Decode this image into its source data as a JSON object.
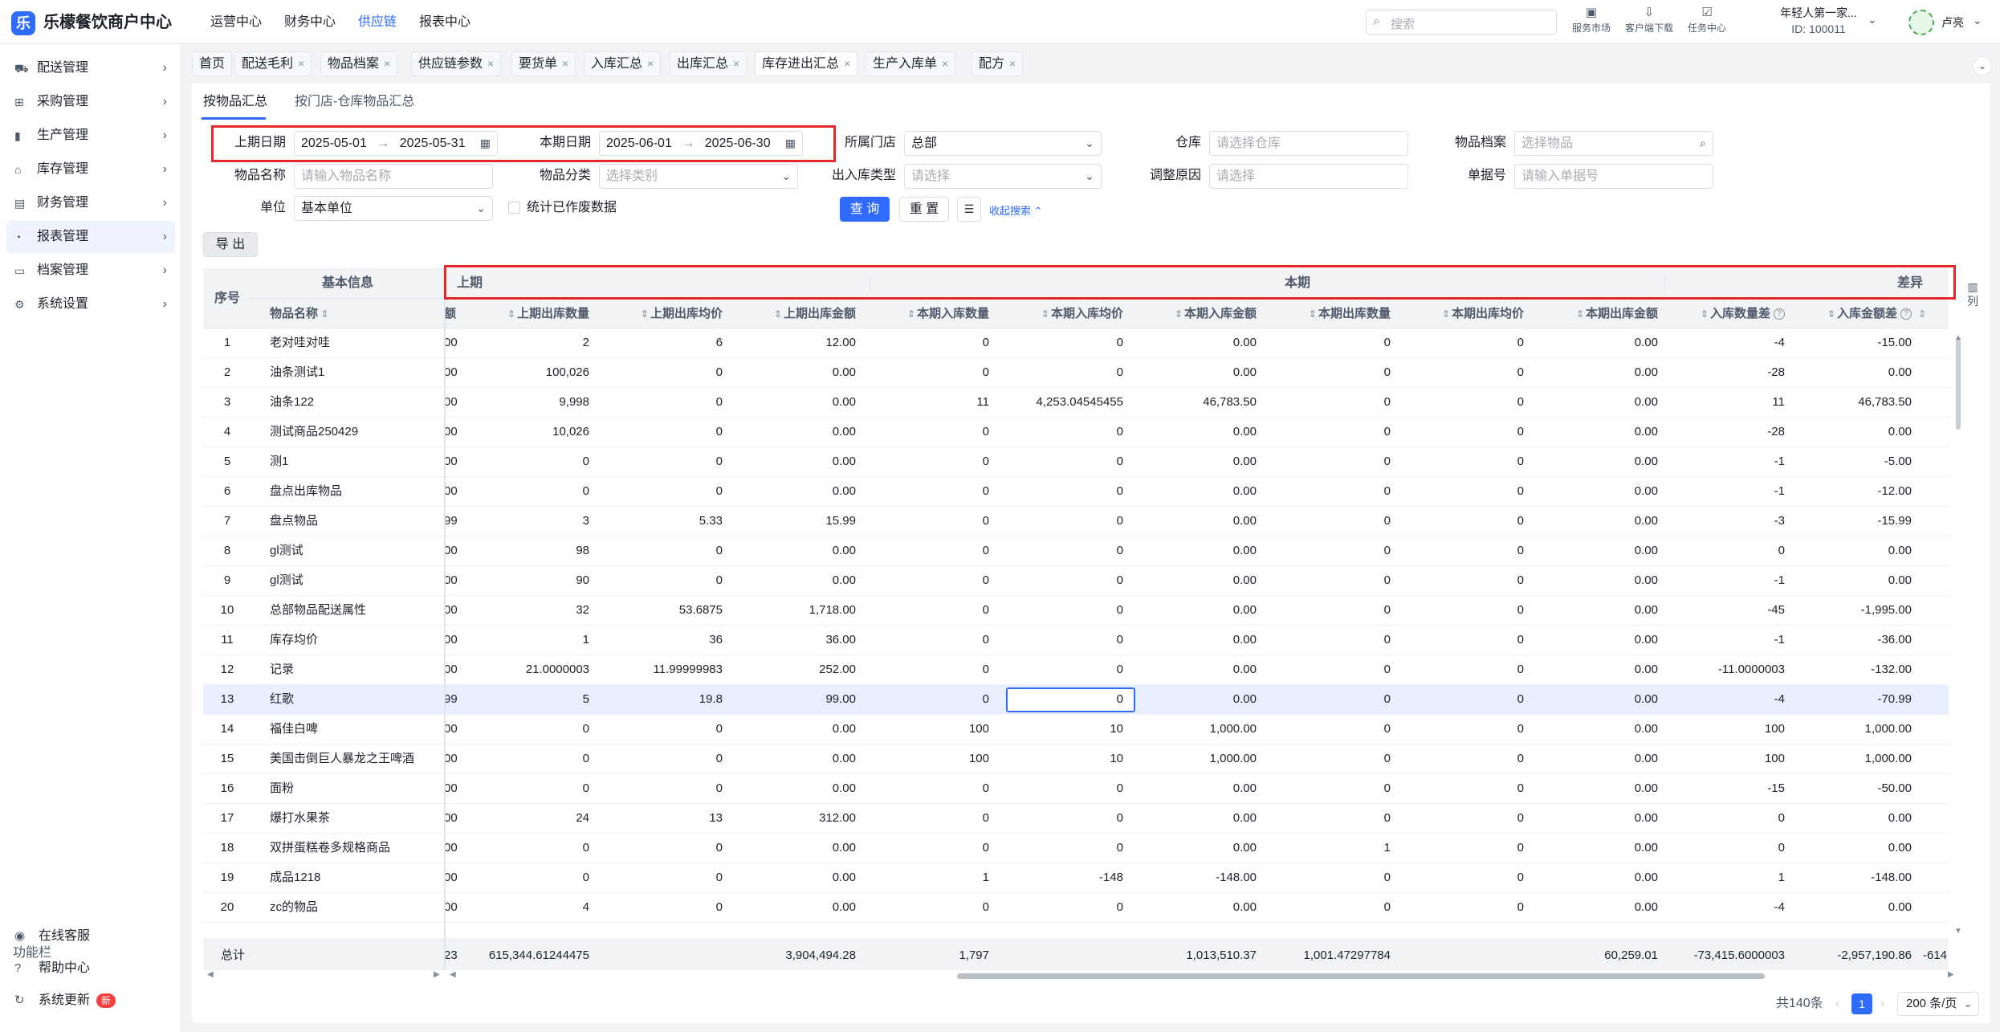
{
  "app": {
    "title": "乐檬餐饮商户中心",
    "logo_glyph": "乐"
  },
  "topnav": [
    {
      "label": "运营中心",
      "active": false
    },
    {
      "label": "财务中心",
      "active": false
    },
    {
      "label": "供应链",
      "active": true
    },
    {
      "label": "报表中心",
      "active": false
    }
  ],
  "search": {
    "placeholder": "搜索",
    "icon": "search-icon"
  },
  "tools": [
    {
      "label": "服务市场",
      "icon": "store-icon",
      "glyph": "▣"
    },
    {
      "label": "客户端下载",
      "icon": "download-icon",
      "glyph": "⇩"
    },
    {
      "label": "任务中心",
      "icon": "task-icon",
      "glyph": "☑"
    }
  ],
  "user": {
    "org": "年轻人第一家...",
    "id": "ID: 100011",
    "name": "卢亮"
  },
  "sidebar": {
    "items": [
      {
        "label": "配送管理",
        "icon": "truck-icon",
        "glyph": "⛟",
        "active": false
      },
      {
        "label": "采购管理",
        "icon": "cart-icon",
        "glyph": "⊞",
        "active": false
      },
      {
        "label": "生产管理",
        "icon": "bar-chart-icon",
        "glyph": "▮",
        "active": false
      },
      {
        "label": "库存管理",
        "icon": "warehouse-icon",
        "glyph": "⌂",
        "active": false
      },
      {
        "label": "财务管理",
        "icon": "wallet-icon",
        "glyph": "▤",
        "active": false
      },
      {
        "label": "报表管理",
        "icon": "report-icon",
        "glyph": "◔",
        "active": true
      },
      {
        "label": "档案管理",
        "icon": "archive-icon",
        "glyph": "▭",
        "active": false
      },
      {
        "label": "系统设置",
        "icon": "gear-icon",
        "glyph": "⚙",
        "active": false
      }
    ],
    "section_label": "功能栏",
    "footer": [
      {
        "label": "在线客服",
        "icon": "headset-icon",
        "glyph": "◉"
      },
      {
        "label": "帮助中心",
        "icon": "help-icon",
        "glyph": "?"
      },
      {
        "label": "系统更新",
        "icon": "refresh-icon",
        "glyph": "↻",
        "badge": "新"
      }
    ]
  },
  "tabs": [
    {
      "label": "首页",
      "closable": false,
      "active": false
    },
    {
      "label": "配送毛利",
      "closable": true,
      "active": false
    },
    {
      "label": "物品档案",
      "closable": true,
      "active": false
    },
    {
      "label": "供应链参数",
      "closable": true,
      "active": false
    },
    {
      "label": "要货单",
      "closable": true,
      "active": false
    },
    {
      "label": "入库汇总",
      "closable": true,
      "active": false
    },
    {
      "label": "出库汇总",
      "closable": true,
      "active": false
    },
    {
      "label": "库存进出汇总",
      "closable": true,
      "active": true
    },
    {
      "label": "生产入库单",
      "closable": true,
      "active": false
    },
    {
      "label": "配方",
      "closable": true,
      "active": false
    }
  ],
  "subtabs": [
    {
      "label": "按物品汇总",
      "active": true
    },
    {
      "label": "按门店-仓库物品汇总",
      "active": false
    }
  ],
  "filters": {
    "prev_period": {
      "label": "上期日期",
      "start": "2025-05-01",
      "end": "2025-05-31",
      "sep": "→"
    },
    "cur_period": {
      "label": "本期日期",
      "start": "2025-06-01",
      "end": "2025-06-30",
      "sep": "→"
    },
    "store": {
      "label": "所属门店",
      "value": "总部"
    },
    "warehouse": {
      "label": "仓库",
      "placeholder": "请选择仓库"
    },
    "item_file": {
      "label": "物品档案",
      "placeholder": "选择物品"
    },
    "item_name": {
      "label": "物品名称",
      "placeholder": "请输入物品名称"
    },
    "item_category": {
      "label": "物品分类",
      "placeholder": "选择类别"
    },
    "io_type": {
      "label": "出入库类型",
      "placeholder": "请选择"
    },
    "adjust_reason": {
      "label": "调整原因",
      "placeholder": "请选择"
    },
    "doc_no": {
      "label": "单据号",
      "placeholder": "请输入单据号"
    },
    "unit": {
      "label": "单位",
      "value": "基本单位"
    },
    "voided": {
      "label": "统计已作废数据",
      "checked": false
    },
    "query_btn": "查 询",
    "reset_btn": "重 置",
    "collapse_link": "收起搜索"
  },
  "export_btn": "导 出",
  "table": {
    "groups": {
      "basic": "基本信息",
      "prev": "上期",
      "cur": "本期",
      "diff": "差异"
    },
    "headers": {
      "seq": "序号",
      "name": "物品名称",
      "prev_amount_cut": "额",
      "prev_out_qty": "上期出库数量",
      "prev_out_avg": "上期出库均价",
      "prev_out_amt": "上期出库金额",
      "cur_in_qty": "本期入库数量",
      "cur_in_avg": "本期入库均价",
      "cur_in_amt": "本期入库金额",
      "cur_out_qty": "本期出库数量",
      "cur_out_avg": "本期出库均价",
      "cur_out_amt": "本期出库金额",
      "in_qty_diff": "入库数量差",
      "in_amt_diff": "入库金额差",
      "next_cut": "⇕"
    },
    "rows": [
      {
        "seq": "1",
        "name": "老对哇对哇",
        "pre": "00",
        "poq": "2",
        "poa": "6",
        "pom": "12.00",
        "ciq": "0",
        "cia": "0",
        "cim": "0.00",
        "coq": "0",
        "coa": "0",
        "com": "0.00",
        "dq": "-4",
        "dm": "-15.00"
      },
      {
        "seq": "2",
        "name": "油条测试1",
        "pre": "00",
        "poq": "100,026",
        "poa": "0",
        "pom": "0.00",
        "ciq": "0",
        "cia": "0",
        "cim": "0.00",
        "coq": "0",
        "coa": "0",
        "com": "0.00",
        "dq": "-28",
        "dm": "0.00"
      },
      {
        "seq": "3",
        "name": "油条122",
        "pre": "00",
        "poq": "9,998",
        "poa": "0",
        "pom": "0.00",
        "ciq": "11",
        "cia": "4,253.04545455",
        "cim": "46,783.50",
        "coq": "0",
        "coa": "0",
        "com": "0.00",
        "dq": "11",
        "dm": "46,783.50"
      },
      {
        "seq": "4",
        "name": "测试商品250429",
        "pre": "00",
        "poq": "10,026",
        "poa": "0",
        "pom": "0.00",
        "ciq": "0",
        "cia": "0",
        "cim": "0.00",
        "coq": "0",
        "coa": "0",
        "com": "0.00",
        "dq": "-28",
        "dm": "0.00"
      },
      {
        "seq": "5",
        "name": "测1",
        "pre": "00",
        "poq": "0",
        "poa": "0",
        "pom": "0.00",
        "ciq": "0",
        "cia": "0",
        "cim": "0.00",
        "coq": "0",
        "coa": "0",
        "com": "0.00",
        "dq": "-1",
        "dm": "-5.00"
      },
      {
        "seq": "6",
        "name": "盘点出库物品",
        "pre": "00",
        "poq": "0",
        "poa": "0",
        "pom": "0.00",
        "ciq": "0",
        "cia": "0",
        "cim": "0.00",
        "coq": "0",
        "coa": "0",
        "com": "0.00",
        "dq": "-1",
        "dm": "-12.00"
      },
      {
        "seq": "7",
        "name": "盘点物品",
        "pre": "99",
        "poq": "3",
        "poa": "5.33",
        "pom": "15.99",
        "ciq": "0",
        "cia": "0",
        "cim": "0.00",
        "coq": "0",
        "coa": "0",
        "com": "0.00",
        "dq": "-3",
        "dm": "-15.99"
      },
      {
        "seq": "8",
        "name": "gl测试",
        "pre": "00",
        "poq": "98",
        "poa": "0",
        "pom": "0.00",
        "ciq": "0",
        "cia": "0",
        "cim": "0.00",
        "coq": "0",
        "coa": "0",
        "com": "0.00",
        "dq": "0",
        "dm": "0.00"
      },
      {
        "seq": "9",
        "name": "gl测试",
        "pre": "00",
        "poq": "90",
        "poa": "0",
        "pom": "0.00",
        "ciq": "0",
        "cia": "0",
        "cim": "0.00",
        "coq": "0",
        "coa": "0",
        "com": "0.00",
        "dq": "-1",
        "dm": "0.00"
      },
      {
        "seq": "10",
        "name": "总部物品配送属性",
        "pre": "00",
        "poq": "32",
        "poa": "53.6875",
        "pom": "1,718.00",
        "ciq": "0",
        "cia": "0",
        "cim": "0.00",
        "coq": "0",
        "coa": "0",
        "com": "0.00",
        "dq": "-45",
        "dm": "-1,995.00"
      },
      {
        "seq": "11",
        "name": "库存均价",
        "pre": "00",
        "poq": "1",
        "poa": "36",
        "pom": "36.00",
        "ciq": "0",
        "cia": "0",
        "cim": "0.00",
        "coq": "0",
        "coa": "0",
        "com": "0.00",
        "dq": "-1",
        "dm": "-36.00"
      },
      {
        "seq": "12",
        "name": "记录",
        "pre": "00",
        "poq": "21.0000003",
        "poa": "11.99999983",
        "pom": "252.00",
        "ciq": "0",
        "cia": "0",
        "cim": "0.00",
        "coq": "0",
        "coa": "0",
        "com": "0.00",
        "dq": "-11.0000003",
        "dm": "-132.00"
      },
      {
        "seq": "13",
        "name": "红歌",
        "pre": "99",
        "poq": "5",
        "poa": "19.8",
        "pom": "99.00",
        "ciq": "0",
        "cia": "0",
        "cim": "0.00",
        "coq": "0",
        "coa": "0",
        "com": "0.00",
        "dq": "-4",
        "dm": "-70.99",
        "selected": true
      },
      {
        "seq": "14",
        "name": "福佳白啤",
        "pre": "00",
        "poq": "0",
        "poa": "0",
        "pom": "0.00",
        "ciq": "100",
        "cia": "10",
        "cim": "1,000.00",
        "coq": "0",
        "coa": "0",
        "com": "0.00",
        "dq": "100",
        "dm": "1,000.00"
      },
      {
        "seq": "15",
        "name": "美国击倒巨人暴龙之王啤酒",
        "pre": "00",
        "poq": "0",
        "poa": "0",
        "pom": "0.00",
        "ciq": "100",
        "cia": "10",
        "cim": "1,000.00",
        "coq": "0",
        "coa": "0",
        "com": "0.00",
        "dq": "100",
        "dm": "1,000.00"
      },
      {
        "seq": "16",
        "name": "面粉",
        "pre": "00",
        "poq": "0",
        "poa": "0",
        "pom": "0.00",
        "ciq": "0",
        "cia": "0",
        "cim": "0.00",
        "coq": "0",
        "coa": "0",
        "com": "0.00",
        "dq": "-15",
        "dm": "-50.00"
      },
      {
        "seq": "17",
        "name": "爆打水果茶",
        "pre": "00",
        "poq": "24",
        "poa": "13",
        "pom": "312.00",
        "ciq": "0",
        "cia": "0",
        "cim": "0.00",
        "coq": "0",
        "coa": "0",
        "com": "0.00",
        "dq": "0",
        "dm": "0.00"
      },
      {
        "seq": "18",
        "name": "双拼蛋糕卷多规格商品",
        "pre": "00",
        "poq": "0",
        "poa": "0",
        "pom": "0.00",
        "ciq": "0",
        "cia": "0",
        "cim": "0.00",
        "coq": "1",
        "coa": "0",
        "com": "0.00",
        "dq": "0",
        "dm": "0.00"
      },
      {
        "seq": "19",
        "name": "成品1218",
        "pre": "00",
        "poq": "0",
        "poa": "0",
        "pom": "0.00",
        "ciq": "1",
        "cia": "-148",
        "cim": "-148.00",
        "coq": "0",
        "coa": "0",
        "com": "0.00",
        "dq": "1",
        "dm": "-148.00"
      },
      {
        "seq": "20",
        "name": "zc的物品",
        "pre": "00",
        "poq": "4",
        "poa": "0",
        "pom": "0.00",
        "ciq": "0",
        "cia": "0",
        "cim": "0.00",
        "coq": "0",
        "coa": "0",
        "com": "0.00",
        "dq": "-4",
        "dm": "0.00"
      }
    ],
    "footer": {
      "label": "总计",
      "pre": "23",
      "poq": "615,344.61244475",
      "poa": "",
      "pom": "3,904,494.28",
      "ciq": "1,797",
      "cia": "",
      "cim": "1,013,510.37",
      "coq": "1,001.47297784",
      "coa": "",
      "com": "60,259.01",
      "dq": "-73,415.6000003",
      "dm": "-2,957,190.86",
      "next": "-614"
    }
  },
  "column_settings": "列",
  "pagination": {
    "total": "共140条",
    "current": "1",
    "page_size": "200 条/页",
    "prev": "‹",
    "next": "›"
  },
  "colors": {
    "accent": "#2f6bff",
    "highlight": "#e5292a",
    "selected_row": "#e8efff"
  }
}
